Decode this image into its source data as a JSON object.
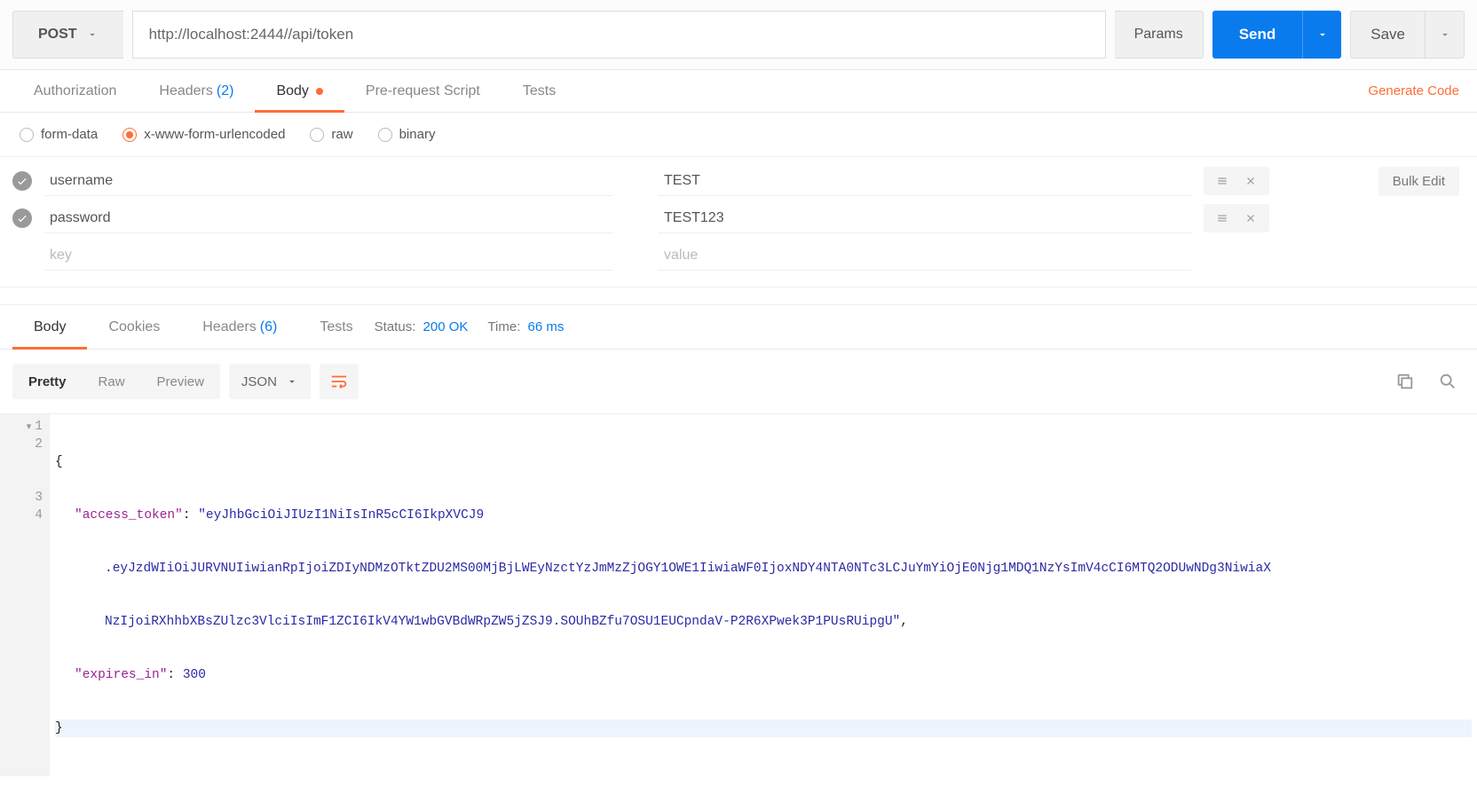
{
  "request": {
    "method": "POST",
    "url": "http://localhost:2444//api/token",
    "params_label": "Params",
    "send_label": "Send",
    "save_label": "Save"
  },
  "request_tabs": {
    "authorization": "Authorization",
    "headers": "Headers",
    "headers_count": "(2)",
    "body": "Body",
    "prerequest": "Pre-request Script",
    "tests": "Tests",
    "generate_code": "Generate Code"
  },
  "body_types": {
    "form_data": "form-data",
    "urlencoded": "x-www-form-urlencoded",
    "raw": "raw",
    "binary": "binary",
    "selected": "urlencoded"
  },
  "body_kv": {
    "rows": [
      {
        "key": "username",
        "value": "TEST",
        "enabled": true
      },
      {
        "key": "password",
        "value": "TEST123",
        "enabled": true
      }
    ],
    "placeholder_key": "key",
    "placeholder_value": "value",
    "bulk_edit": "Bulk Edit"
  },
  "response_tabs": {
    "body": "Body",
    "cookies": "Cookies",
    "headers": "Headers",
    "headers_count": "(6)",
    "tests": "Tests"
  },
  "response_meta": {
    "status_label": "Status:",
    "status_value": "200 OK",
    "time_label": "Time:",
    "time_value": "66 ms"
  },
  "response_toolbar": {
    "pretty": "Pretty",
    "raw": "Raw",
    "preview": "Preview",
    "format": "JSON"
  },
  "response_body": {
    "access_token_key": "\"access_token\"",
    "access_token_line1": "\"eyJhbGciOiJIUzI1NiIsInR5cCI6IkpXVCJ9",
    "access_token_line2": ".eyJzdWIiOiJURVNUIiwianRpIjoiZDIyNDMzOTktZDU2MS00MjBjLWEyNzctYzJmMzZjOGY1OWE1IiwiaWF0IjoxNDY4NTA0NTc3LCJuYmYiOjE0Njg1MDQ1NzYsImV4cCI6MTQ2ODUwNDg3NiwiaX",
    "access_token_line3": "NzIjoiRXhhbXBsZUlzc3VlciIsImF1ZCI6IkV4YW1wbGVBdWRpZW5jZSJ9.SOUhBZfu7OSU1EUCpndaV-P2R6XPwek3P1PUsRUipgU\"",
    "expires_in_key": "\"expires_in\"",
    "expires_in_value": "300"
  }
}
